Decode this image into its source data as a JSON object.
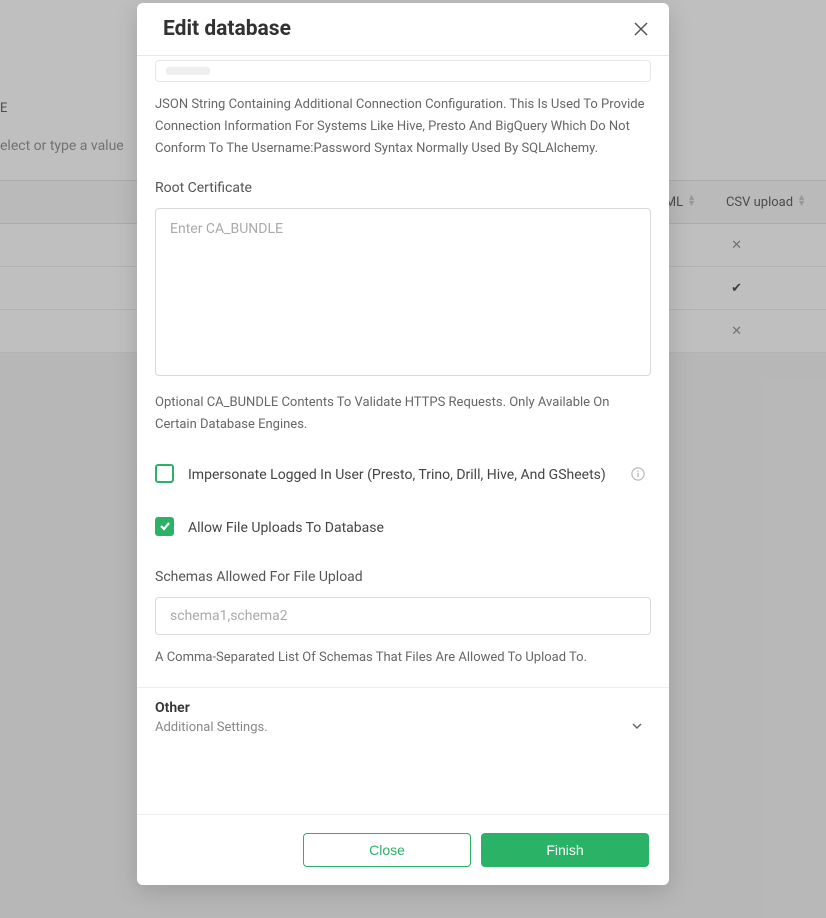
{
  "modal": {
    "title": "Edit database",
    "json_help": "JSON String Containing Additional Connection Configuration. This Is Used To Provide Connection Information For Systems Like Hive, Presto And BigQuery Which Do Not Conform To The Username:Password Syntax Normally Used By SQLAlchemy.",
    "root_cert_label": "Root Certificate",
    "root_cert_placeholder": "Enter CA_BUNDLE",
    "root_cert_help": "Optional CA_BUNDLE Contents To Validate HTTPS Requests. Only Available On Certain Database Engines.",
    "impersonate_label": "Impersonate Logged In User (Presto, Trino, Drill, Hive, And GSheets)",
    "allow_upload_label": "Allow File Uploads To Database",
    "schemas_label": "Schemas Allowed For File Upload",
    "schemas_placeholder": "schema1,schema2",
    "schemas_help": "A Comma-Separated List Of Schemas That Files Are Allowed To Upload To.",
    "other_title": "Other",
    "other_sub": "Additional Settings.",
    "close_btn": "Close",
    "finish_btn": "Finish"
  },
  "background": {
    "filter_label": "E",
    "filter_placeholder": "elect or type a value",
    "col_ml": "ML",
    "col_csv": "CSV upload"
  }
}
